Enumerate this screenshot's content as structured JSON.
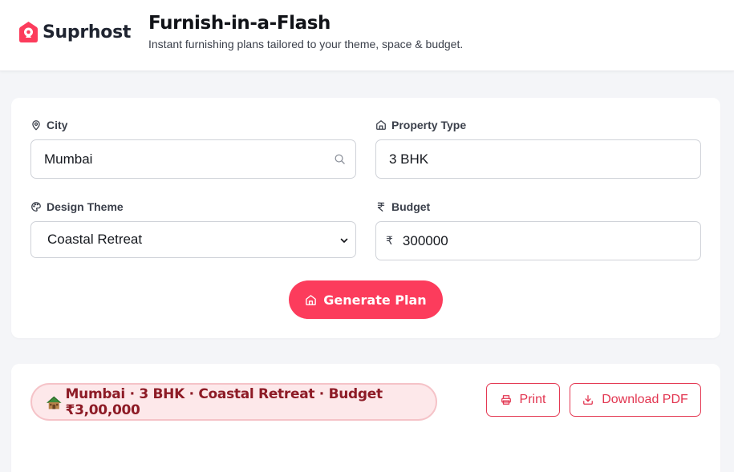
{
  "header": {
    "brand": "Suprhost",
    "title": "Furnish-in-a-Flash",
    "subtitle": "Instant furnishing plans tailored to your theme, space & budget."
  },
  "form": {
    "city": {
      "label": "City",
      "value": "Mumbai",
      "icon": "map-pin-icon"
    },
    "property_type": {
      "label": "Property Type",
      "value": "3 BHK",
      "icon": "home-icon"
    },
    "design_theme": {
      "label": "Design Theme",
      "value": "Coastal Retreat",
      "icon": "palette-icon"
    },
    "budget": {
      "label": "Budget",
      "prefix": "₹",
      "value": "300000",
      "icon": "rupee-icon"
    },
    "generate_label": "Generate Plan"
  },
  "result": {
    "summary": "Mumbai · 3 BHK · Coastal Retreat · Budget ₹3,00,000",
    "print_label": "Print",
    "download_label": "Download PDF"
  },
  "colors": {
    "accent": "#fc3c5c",
    "accent_outline": "#e43953",
    "pill_bg": "#fde8ea",
    "pill_text": "#8d1b26"
  }
}
